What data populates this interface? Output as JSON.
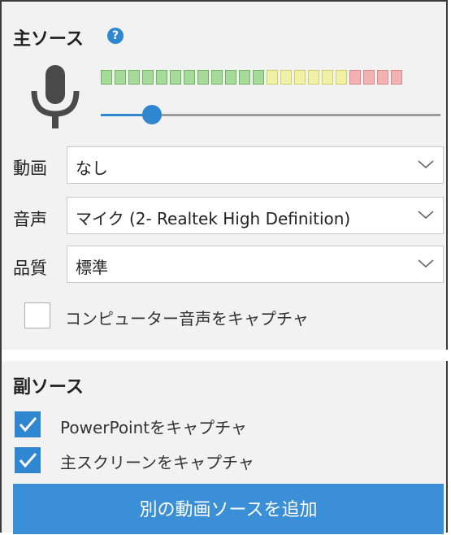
{
  "primary_source": {
    "title": "主ソース",
    "help_icon": "help-icon",
    "mic_icon": "microphone-icon",
    "audio_meter": {
      "green_segments": 12,
      "yellow_segments": 6,
      "red_segments": 4,
      "colors": {
        "green": "#a6d99a",
        "yellow": "#f0f0a6",
        "red": "#f2b2b2"
      }
    },
    "volume_slider": {
      "level": 0.15
    }
  },
  "fields": {
    "video": {
      "label": "動画",
      "value": "なし"
    },
    "audio": {
      "label": "音声",
      "value": "マイク (2- Realtek High Definition)"
    },
    "quality": {
      "label": "品質",
      "value": "標準"
    }
  },
  "capture_computer_audio": {
    "label": "コンピューター音声をキャプチャ",
    "checked": false
  },
  "secondary_source": {
    "title": "副ソース",
    "capture_powerpoint": {
      "label": "PowerPointをキャプチャ",
      "checked": true
    },
    "capture_main_screen": {
      "label": "主スクリーンをキャプチャ",
      "checked": true
    }
  },
  "add_video_source_button": "別の動画ソースを追加",
  "accent_color": "#2f86d1"
}
